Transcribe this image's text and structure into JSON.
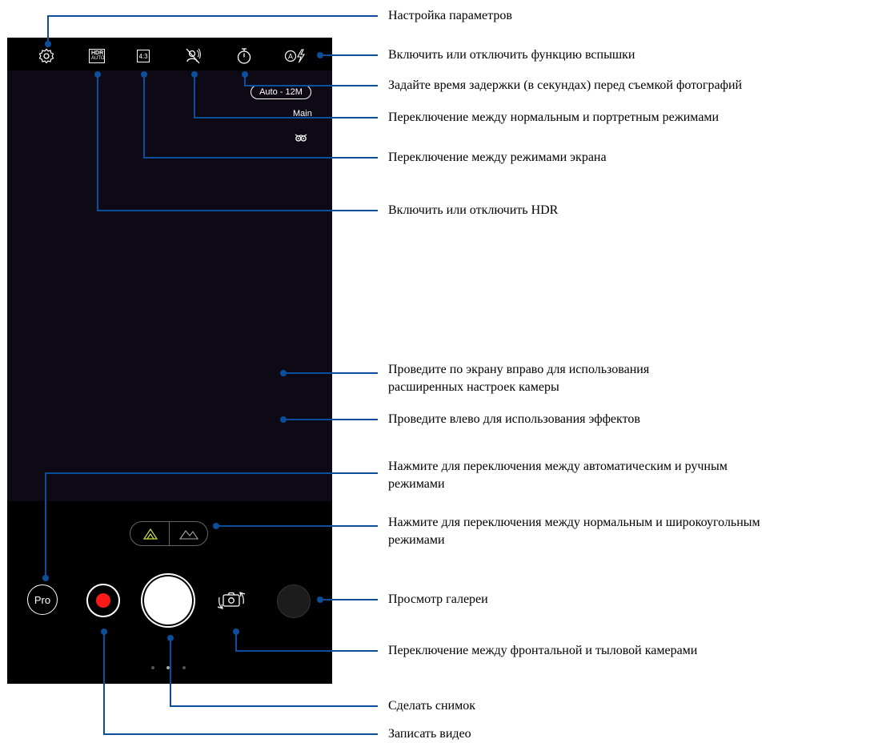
{
  "camera": {
    "toolbar": [
      {
        "name": "settings-icon"
      },
      {
        "name": "hdr-icon",
        "text_top": "HDR",
        "text_bottom": "AUTO"
      },
      {
        "name": "aspect-ratio-icon",
        "text": "4:3"
      },
      {
        "name": "portrait-mode-icon"
      },
      {
        "name": "timer-icon"
      },
      {
        "name": "flash-auto-icon"
      }
    ],
    "resolution": "Auto - 12M",
    "lens_label": "Main",
    "mode_button": "Pro",
    "page_dots": 3,
    "active_page_dot": 2
  },
  "callouts": [
    {
      "id": "settings",
      "text": "Настройка параметров"
    },
    {
      "id": "flash",
      "text": "Включить или отключить функцию вспышки"
    },
    {
      "id": "timer",
      "text": "Задайте время задержки (в секундах) перед съемкой фотографий"
    },
    {
      "id": "portrait",
      "text": "Переключение между нормальным и портретным режимами"
    },
    {
      "id": "screen-mode",
      "text": "Переключение между режимами экрана"
    },
    {
      "id": "hdr",
      "text": "Включить или отключить HDR"
    },
    {
      "id": "swipe-right",
      "text": "Проведите по экрану вправо для использования\nрасширенных настроек камеры"
    },
    {
      "id": "swipe-left",
      "text": "Проведите влево для использования эффектов"
    },
    {
      "id": "pro-mode",
      "text": "Нажмите для переключения между автоматическим и ручным\nрежимами"
    },
    {
      "id": "lens",
      "text": "Нажмите для переключения между нормальным и широкоугольным\nрежимами"
    },
    {
      "id": "gallery",
      "text": "Просмотр галереи"
    },
    {
      "id": "switch-camera",
      "text": "Переключение между фронтальной и тыловой камерами"
    },
    {
      "id": "take-photo",
      "text": "Сделать снимок"
    },
    {
      "id": "record-video",
      "text": "Записать видео"
    }
  ],
  "colors": {
    "leader": "#0b4f9c",
    "record": "#ff1a1a",
    "lens_active": "#c6e23a"
  }
}
